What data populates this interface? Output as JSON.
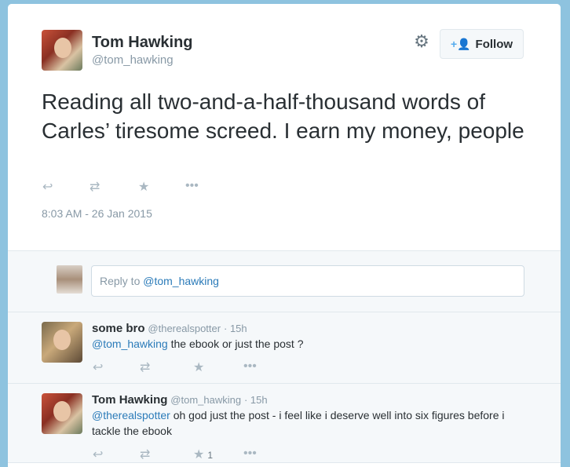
{
  "tweet": {
    "author_name": "Tom Hawking",
    "author_handle": "@tom_hawking",
    "follow_label": "Follow",
    "text": "Reading all two-and-a-half-thousand words of Carles’ tiresome screed. I earn my money, people",
    "timestamp": "8:03 AM - 26 Jan 2015"
  },
  "reply_box": {
    "prefix": "Reply to ",
    "mention": "@tom_hawking"
  },
  "replies": [
    {
      "name": "some bro",
      "handle": "@therealspotter",
      "time": "· 15h",
      "mention": "@tom_hawking",
      "text": " the ebook or just the post ?",
      "fav_count": ""
    },
    {
      "name": "Tom Hawking",
      "handle": "@tom_hawking",
      "time": "· 15h",
      "mention": "@therealspotter",
      "text": " oh god just the post - i feel like i deserve well into six figures before i tackle the ebook",
      "fav_count": "1"
    }
  ],
  "icons": [
    "gear-icon",
    "follow-person-icon",
    "reply-icon",
    "retweet-icon",
    "favorite-icon",
    "more-icon"
  ],
  "colors": {
    "background": "#8ec3df",
    "link": "#2b7bb9",
    "accent": "#55acee",
    "muted": "#8899a6"
  }
}
